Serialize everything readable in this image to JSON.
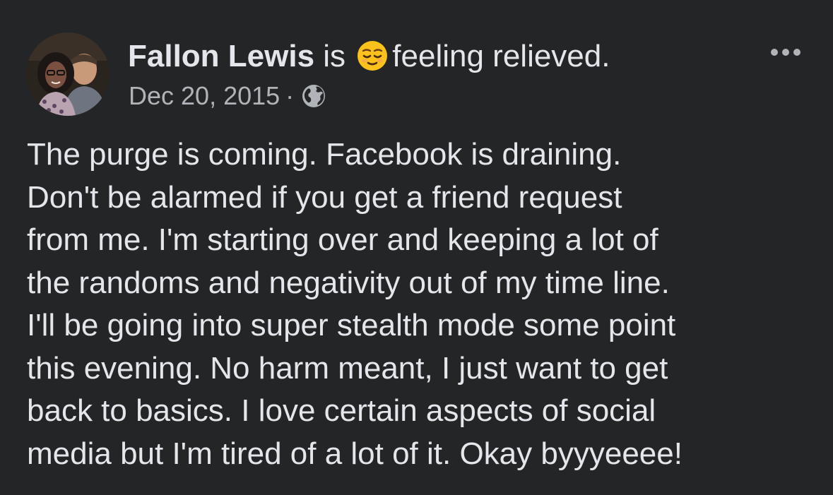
{
  "post": {
    "author_name": "Fallon Lewis",
    "activity_prefix": " is ",
    "activity_text": "feeling relieved.",
    "activity_emoji": "relieved-face",
    "timestamp": "Dec 20, 2015",
    "separator": "·",
    "privacy_icon": "globe-icon",
    "more_icon": "more-options-icon",
    "body": "The purge is coming.  Facebook is draining.\nDon't be alarmed if you get a friend request\nfrom me. I'm starting over and keeping a lot of\nthe randoms and negativity out of my time line.\nI'll be going into super stealth mode some point\nthis evening.  No harm meant, I just want to get\nback to basics. I love certain aspects of social\nmedia but I'm tired of a lot of it. Okay byyyeeee!"
  },
  "colors": {
    "background": "#242526",
    "primary_text": "#e4e6eb",
    "secondary_text": "#b0b3b8",
    "emoji_yellow": "#fcc21b"
  }
}
